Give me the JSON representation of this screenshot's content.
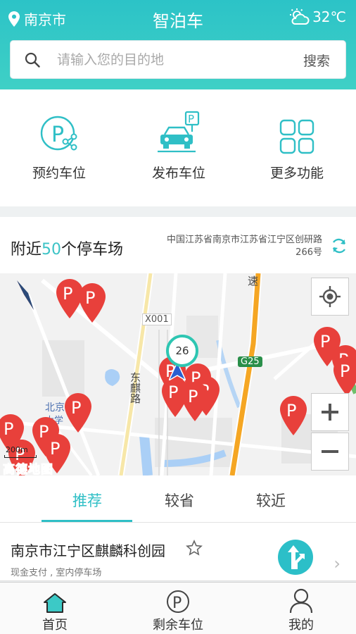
{
  "header": {
    "city": "南京市",
    "title": "智泊车",
    "temperature": "32℃"
  },
  "search": {
    "placeholder": "请输入您的目的地",
    "button": "搜索"
  },
  "functions": [
    {
      "label": "预约车位",
      "icon": "reserve-parking-icon"
    },
    {
      "label": "发布车位",
      "icon": "publish-parking-icon"
    },
    {
      "label": "更多功能",
      "icon": "more-functions-icon"
    }
  ],
  "nearby": {
    "prefix": "附近",
    "count": "50",
    "suffix": "个停车场",
    "address_line1": "中国江苏省南京市江苏省江宁区创研路",
    "address_line2": "266号"
  },
  "map": {
    "labels": {
      "road_x001": "X001",
      "road_dongqi": "东麒路",
      "road_g25": "G25",
      "road_su": "速",
      "poi_beijing": "北京",
      "poi_beijing2": "大学"
    },
    "cluster_count": "26",
    "scale": "200m",
    "logo": "高德地图"
  },
  "tabs": [
    {
      "label": "推荐",
      "active": true
    },
    {
      "label": "较省",
      "active": false
    },
    {
      "label": "较近",
      "active": false
    }
  ],
  "result": {
    "name": "南京市江宁区麒麟科创园",
    "subtitle": "现金支付 , 室内停车场"
  },
  "bottom_nav": [
    {
      "label": "首页",
      "icon": "home-icon"
    },
    {
      "label": "剩余车位",
      "icon": "parking-icon"
    },
    {
      "label": "我的",
      "icon": "profile-icon"
    }
  ],
  "colors": {
    "accent": "#2fbfc6",
    "pin": "#e8403b",
    "highway": "#f5a623"
  }
}
